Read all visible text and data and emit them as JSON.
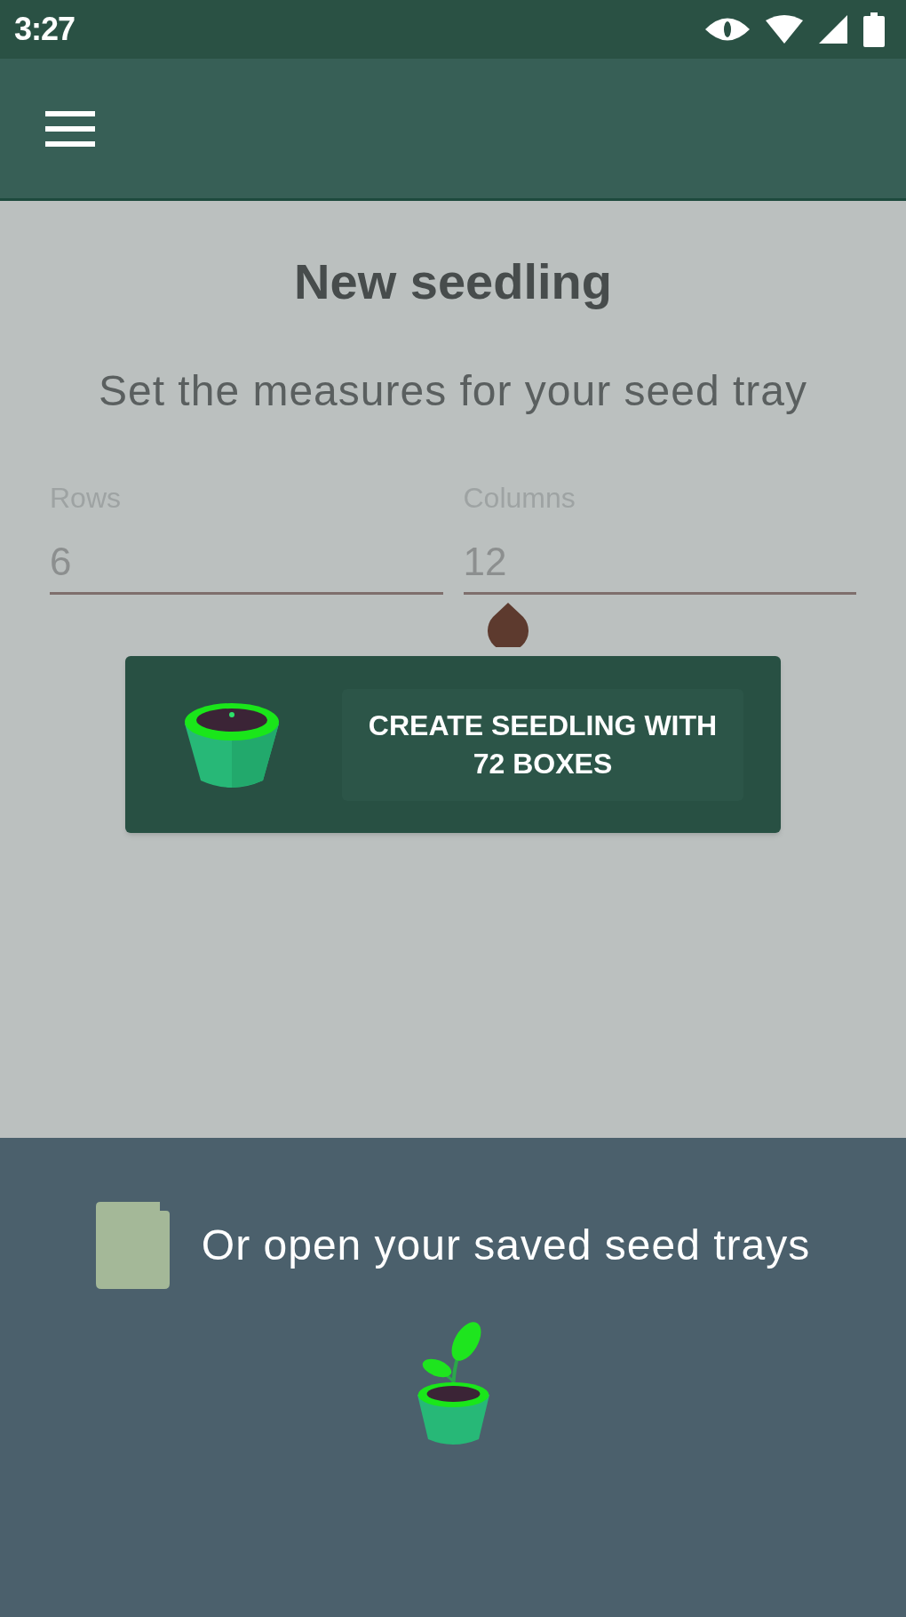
{
  "status_bar": {
    "time": "3:27"
  },
  "header": {
    "title": "New seedling",
    "subtitle": "Set the measures for your seed tray"
  },
  "fields": [
    {
      "label": "Rows",
      "value": "6",
      "focused": false
    },
    {
      "label": "Columns",
      "value": "12",
      "focused": true
    }
  ],
  "create_button": {
    "label": "CREATE SEEDLING WITH 72 BOXES"
  },
  "saved_trays": {
    "label": "Or open your saved seed trays"
  }
}
